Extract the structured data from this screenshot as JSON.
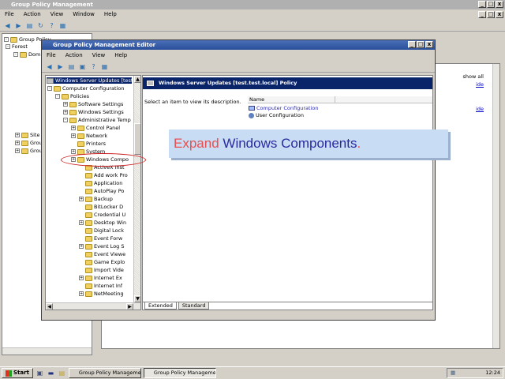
{
  "outer_window": {
    "title": "Group Policy Management",
    "menu": [
      "File",
      "Action",
      "View",
      "Window",
      "Help"
    ],
    "tree": [
      "Group Policy",
      "Forest",
      "Dom",
      "Site",
      "Grou",
      "Grou"
    ],
    "right_links": {
      "show_all": "show all",
      "link1": "ide",
      "link2": "ide"
    }
  },
  "editor": {
    "title": "Group Policy Management Editor",
    "menu": [
      "File",
      "Action",
      "View",
      "Help"
    ],
    "tree_root": "Windows Server Updates [test",
    "tree": [
      {
        "label": "Computer Configuration",
        "indent": 0,
        "pm": "-"
      },
      {
        "label": "Policies",
        "indent": 1,
        "pm": "-"
      },
      {
        "label": "Software Settings",
        "indent": 2,
        "pm": "+"
      },
      {
        "label": "Windows Settings",
        "indent": 2,
        "pm": "+"
      },
      {
        "label": "Administrative Temp",
        "indent": 2,
        "pm": "-"
      },
      {
        "label": "Control Panel",
        "indent": 3,
        "pm": "+"
      },
      {
        "label": "Network",
        "indent": 3,
        "pm": "+"
      },
      {
        "label": "Printers",
        "indent": 3,
        "pm": ""
      },
      {
        "label": "System",
        "indent": 3,
        "pm": "+"
      },
      {
        "label": "Windows Compo",
        "indent": 3,
        "pm": "+"
      },
      {
        "label": "ActiveX Inst",
        "indent": 4,
        "pm": ""
      },
      {
        "label": "Add work Pro",
        "indent": 4,
        "pm": ""
      },
      {
        "label": "Application",
        "indent": 4,
        "pm": ""
      },
      {
        "label": "AutoPlay Po",
        "indent": 4,
        "pm": ""
      },
      {
        "label": "Backup",
        "indent": 4,
        "pm": "+"
      },
      {
        "label": "BitLocker D",
        "indent": 4,
        "pm": ""
      },
      {
        "label": "Credential U",
        "indent": 4,
        "pm": ""
      },
      {
        "label": "Desktop Win",
        "indent": 4,
        "pm": "+"
      },
      {
        "label": "Digital Lock",
        "indent": 4,
        "pm": ""
      },
      {
        "label": "Event Forw",
        "indent": 4,
        "pm": ""
      },
      {
        "label": "Event Log S",
        "indent": 4,
        "pm": "+"
      },
      {
        "label": "Event Viewe",
        "indent": 4,
        "pm": ""
      },
      {
        "label": "Game Explo",
        "indent": 4,
        "pm": ""
      },
      {
        "label": "Import Vide",
        "indent": 4,
        "pm": ""
      },
      {
        "label": "Internet Ex",
        "indent": 4,
        "pm": "+"
      },
      {
        "label": "Internet Inf",
        "indent": 4,
        "pm": ""
      },
      {
        "label": "NetMeeting",
        "indent": 4,
        "pm": "+"
      }
    ],
    "right_header": "Windows Server Updates [test.test.local] Policy",
    "description": "Select an item to view its description.",
    "column_name": "Name",
    "items": [
      "Computer Configuration",
      "User Configuration"
    ],
    "tabs": [
      "Extended",
      "Standard"
    ]
  },
  "instruction": {
    "prefix": "Expand",
    "highlight": "Windows Components",
    "suffix": "."
  },
  "taskbar": {
    "start": "Start",
    "buttons": [
      "Group Policy Management",
      "Group Policy Manageme..."
    ],
    "clock": "12:24"
  },
  "colors": {
    "instruction_prefix": "#e85050",
    "instruction_highlight": "#2a2aa0",
    "highlight_ellipse": "#cc2020",
    "header_bg": "#0a246a"
  }
}
